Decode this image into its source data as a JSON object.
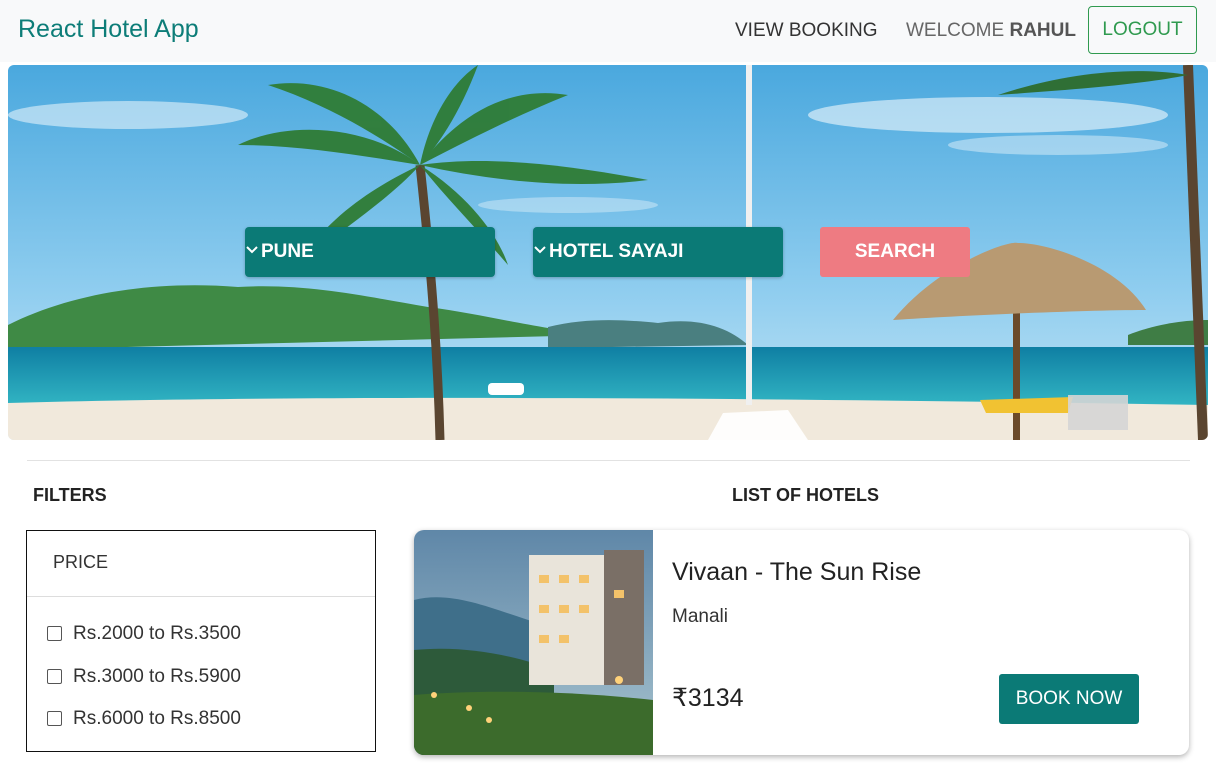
{
  "navbar": {
    "brand": "React Hotel App",
    "view_booking": "VIEW BOOKING",
    "welcome_prefix": "WELCOME",
    "username": "RAHUL",
    "logout": "LOGOUT"
  },
  "hero": {
    "city_select": {
      "selected": "PUNE"
    },
    "hotel_select": {
      "selected": "HOTEL SAYAJI"
    },
    "search_label": "SEARCH"
  },
  "filters": {
    "title": "FILTERS",
    "price_header": "PRICE",
    "options": [
      "Rs.2000 to Rs.3500",
      "Rs.3000 to Rs.5900",
      "Rs.6000 to Rs.8500"
    ]
  },
  "hotels": {
    "title": "LIST OF HOTELS",
    "items": [
      {
        "name": "Vivaan - The Sun Rise",
        "location": "Manali",
        "price": "₹3134",
        "book_label": "BOOK NOW"
      }
    ]
  },
  "colors": {
    "brand": "#0d7d78",
    "teal": "#0b7a76",
    "search": "#ee7b82",
    "logout": "#2f9a4f"
  }
}
